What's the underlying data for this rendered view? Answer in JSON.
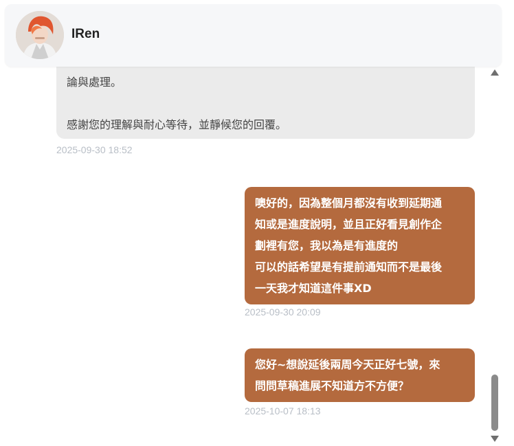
{
  "header": {
    "name": "IRen"
  },
  "messages": [
    {
      "direction": "incoming",
      "lines": [
        "論與處理。",
        "",
        "感謝您的理解與耐心等待，並靜候您的回覆。"
      ],
      "timestamp": "2025-09-30 18:52"
    },
    {
      "direction": "outgoing",
      "lines": [
        "噢好的，因為整個月都沒有收到延期通",
        "知或是進度說明，並且正好看見創作企",
        "劃裡有您，我以為是有進度的",
        "可以的話希望是有提前通知而不是最後",
        "一天我才知道這件事XD"
      ],
      "timestamp": "2025-09-30 20:09"
    },
    {
      "direction": "outgoing",
      "lines": [
        "您好~想說延後兩周今天正好七號，來",
        "問問草稿進展不知道方不方便？"
      ],
      "timestamp": "2025-10-07 18:13"
    }
  ],
  "colors": {
    "outgoing_bubble": "#b46a3e",
    "incoming_bubble": "#ebebeb",
    "timestamp": "#b8bec6"
  },
  "scrollbar": {
    "position_fraction": 0.95
  }
}
